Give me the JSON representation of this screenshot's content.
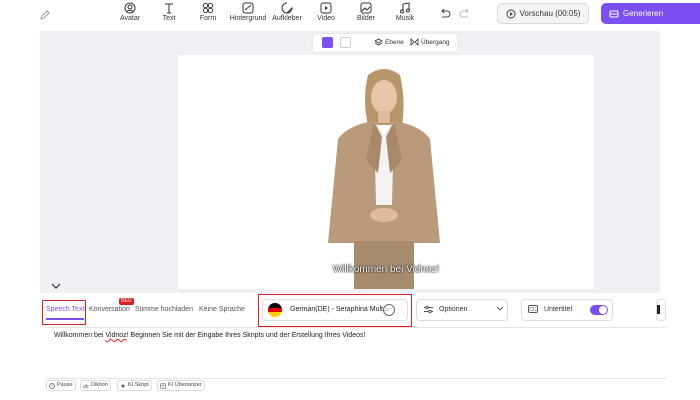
{
  "toolbar": {
    "items": [
      {
        "label": "Avatar",
        "icon": "avatar-icon"
      },
      {
        "label": "Text",
        "icon": "text-icon"
      },
      {
        "label": "Form",
        "icon": "shapes-icon"
      },
      {
        "label": "Hintergrund",
        "icon": "background-icon"
      },
      {
        "label": "Aufkleber",
        "icon": "sticker-icon"
      },
      {
        "label": "Video",
        "icon": "video-icon"
      },
      {
        "label": "Bilder",
        "icon": "images-icon"
      },
      {
        "label": "Musik",
        "icon": "music-icon"
      }
    ],
    "preview_label": "Vorschau (00:05)",
    "generate_label": "Generieren"
  },
  "canvas": {
    "layer_label": "Ebene",
    "transition_label": "Übergang",
    "subtitle": "Willkommen bei Vidnoz!"
  },
  "tabs": {
    "speech_text": "Speech Text",
    "conversation": "Konversation",
    "new_badge": "NEU",
    "upload_voice": "Stimme hochladen",
    "no_speech": "Keine Sprache"
  },
  "voice": {
    "name": "German(DE) - Seraphina Mult...",
    "more": "···"
  },
  "options_label": "Optionen",
  "subtitle_label": "Untertitel",
  "script": {
    "before": "Willkommen bei ",
    "brand": "Vidnoz",
    "after": "! Beginnen Sie mit der Eingabe Ihres Skripts und der Erstellung Ihres Videos!"
  },
  "chips": [
    "Pause",
    "Diktion",
    "KI Skript",
    "KI Übersetzer"
  ],
  "colors": {
    "accent": "#7c4ff0",
    "highlight": "#e02020",
    "workspace": "#eef0f3"
  }
}
